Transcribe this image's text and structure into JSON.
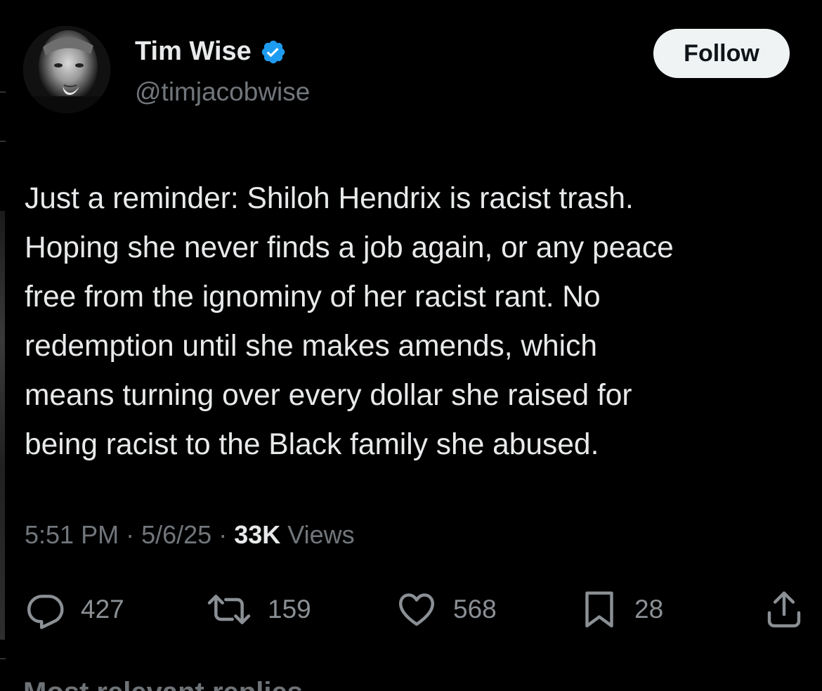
{
  "author": {
    "display_name": "Tim Wise",
    "handle": "@timjacobwise",
    "verified": true
  },
  "follow_button": {
    "label": "Follow"
  },
  "tweet": {
    "text": "Just a reminder: Shiloh Hendrix is racist trash.\nHoping she never finds a job again, or any peace\nfree from the ignominy of her racist rant. No\nredemption until she makes amends, which\nmeans turning over every dollar she raised for\nbeing racist to the Black family she abused."
  },
  "meta": {
    "time": "5:51 PM",
    "separator": "·",
    "date": "5/6/25",
    "views_count": "33K",
    "views_label": "Views"
  },
  "actions": {
    "replies": {
      "icon": "reply-icon",
      "count": "427"
    },
    "reposts": {
      "icon": "repost-icon",
      "count": "159"
    },
    "likes": {
      "icon": "heart-icon",
      "count": "568"
    },
    "bookmarks": {
      "icon": "bookmark-icon",
      "count": "28"
    },
    "share": {
      "icon": "share-icon"
    }
  },
  "next_section": {
    "label": "Most relevant replies"
  },
  "colors": {
    "background": "#000000",
    "text_primary": "#e7e9ea",
    "text_secondary": "#71767b",
    "verified_blue": "#1d9bf0",
    "follow_bg": "#eff3f4"
  }
}
